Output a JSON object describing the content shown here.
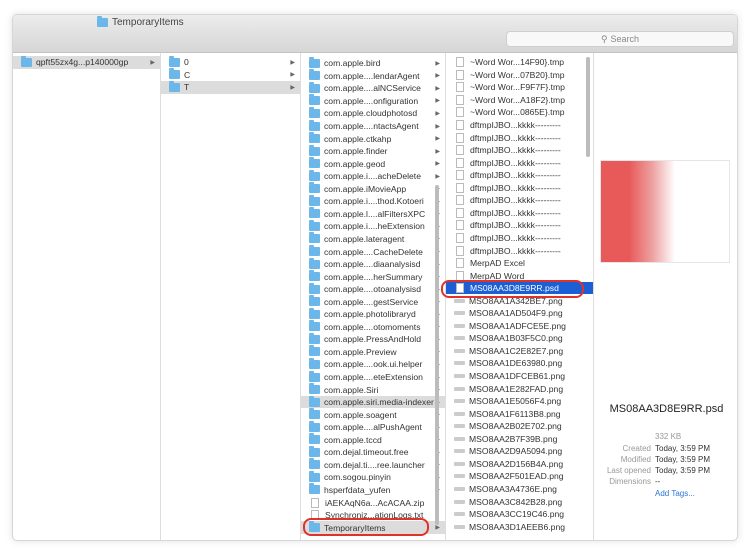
{
  "window": {
    "title": "TemporaryItems",
    "search_placeholder": "Search"
  },
  "col1": [
    {
      "label": "qpft55zx4g...p140000gp"
    }
  ],
  "col2": [
    {
      "label": "0"
    },
    {
      "label": "C"
    },
    {
      "label": "T"
    }
  ],
  "col3": [
    "com.apple.bird",
    "com.apple....lendarAgent",
    "com.apple....alNCService",
    "com.apple....onfiguration",
    "com.apple.cloudphotosd",
    "com.apple....ntactsAgent",
    "com.apple.ctkahp",
    "com.apple.finder",
    "com.apple.geod",
    "com.apple.i....acheDelete",
    "com.apple.iMovieApp",
    "com.apple.i....thod.Kotoeri",
    "com.apple.l....alFiltersXPC",
    "com.apple.i....heExtension",
    "com.apple.lateragent",
    "com.apple....CacheDelete",
    "com.apple....diaanalysisd",
    "com.apple....herSummary",
    "com.apple....otoanalysisd",
    "com.apple....gestService",
    "com.apple.photolibraryd",
    "com.apple....otomoments",
    "com.apple.PressAndHold",
    "com.apple.Preview",
    "com.apple....ook.ui.helper",
    "com.apple....eteExtension",
    "com.apple.Siri",
    "com.apple.siri.media-indexer",
    "com.apple.soagent",
    "com.apple....alPushAgent",
    "com.apple.tccd",
    "com.dejal.timeout.free",
    "com.dejal.ti....ree.launcher",
    "com.sogou.pinyin",
    "hsperfdata_yufen",
    "iAEKAqN6a...AcACAA.zip",
    "Synchroniz...ationLogs.txt",
    "TemporaryItems"
  ],
  "col4": [
    "~Word Wor...14F90}.tmp",
    "~Word Wor...07B20}.tmp",
    "~Word Wor...F9F7F}.tmp",
    "~Word Wor...A18F2}.tmp",
    "~Word Wor...0865E}.tmp",
    "dftmpIJBO...kkkk---------",
    "dftmpIJBO...kkkk---------",
    "dftmpIJBO...kkkk---------",
    "dftmpIJBO...kkkk---------",
    "dftmpIJBO...kkkk---------",
    "dftmpIJBO...kkkk---------",
    "dftmpIJBO...kkkk---------",
    "dftmpIJBO...kkkk---------",
    "dftmpIJBO...kkkk---------",
    "dftmpIJBO...kkkk---------",
    "dftmpIJBO...kkkk---------",
    "MerpAD Excel",
    "MerpAD Word",
    "MS08AA3D8E9RR.psd",
    "MSO8AA1A342BE7.png",
    "MSO8AA1AD504F9.png",
    "MSO8AA1ADFCE5E.png",
    "MSO8AA1B03F5C0.png",
    "MSO8AA1C2E82E7.png",
    "MSO8AA1DE63980.png",
    "MSO8AA1DFCEB61.png",
    "MSO8AA1E282FAD.png",
    "MSO8AA1E5056F4.png",
    "MSO8AA1F6113B8.png",
    "MSO8AA2B02E702.png",
    "MSO8AA2B7F39B.png",
    "MSO8AA2D9A5094.png",
    "MSO8AA2D156B4A.png",
    "MSO8AA2F501EAD.png",
    "MSO8AA3A4736E.png",
    "MSO8AA3C842B28.png",
    "MSO8AA3CC19C46.png",
    "MSO8AA3D1AEEB6.png"
  ],
  "preview": {
    "filename": "MS08AA3D8E9RR.psd",
    "size": "332 KB",
    "created_label": "Created",
    "created": "Today, 3:59 PM",
    "modified_label": "Modified",
    "modified": "Today, 3:59 PM",
    "opened_label": "Last opened",
    "opened": "Today, 3:59 PM",
    "dimensions_label": "Dimensions",
    "dimensions": "--",
    "add_tags": "Add Tags..."
  },
  "colors": {
    "selection": "#1c5fd5",
    "highlight_ring": "#e0322a",
    "folder": "#6cb7ea"
  }
}
